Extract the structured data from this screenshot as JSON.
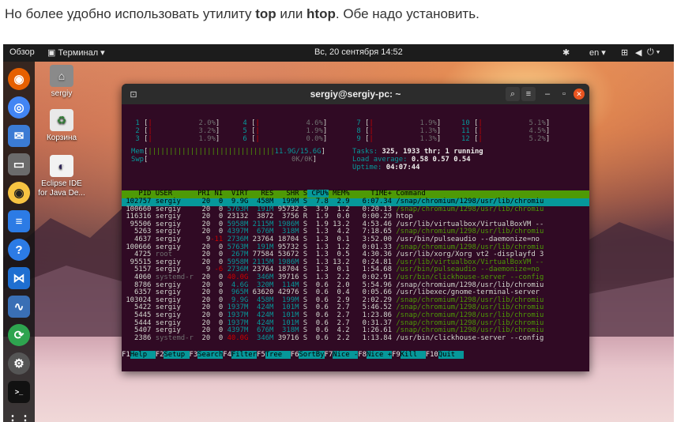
{
  "caption": {
    "before": "Но более удобно использовать утилиту ",
    "bold1": "top",
    "middle": " или ",
    "bold2": "htop",
    "after": ". Обе надо установить."
  },
  "topbar": {
    "activities": "Обзор",
    "app_menu": "Терминал ▾",
    "datetime": "Вс, 20 сентября  14:52",
    "language": "en ▾"
  },
  "desktop_icons": [
    {
      "label": "sergiy"
    },
    {
      "label": "Корзина"
    },
    {
      "label": "Eclipse IDE for Java De..."
    }
  ],
  "terminal": {
    "title": "sergiy@sergiy-pc: ~"
  },
  "htop": {
    "cpus": [
      {
        "id": "1",
        "pct": "2.0%"
      },
      {
        "id": "2",
        "pct": "3.2%"
      },
      {
        "id": "3",
        "pct": "1.9%"
      },
      {
        "id": "4",
        "pct": "4.6%"
      },
      {
        "id": "5",
        "pct": "1.9%"
      },
      {
        "id": "6",
        "pct": "0.0%"
      },
      {
        "id": "7",
        "pct": "1.9%"
      },
      {
        "id": "8",
        "pct": "1.3%"
      },
      {
        "id": "9",
        "pct": "1.3%"
      },
      {
        "id": "10",
        "pct": "5.1%"
      },
      {
        "id": "11",
        "pct": "4.5%"
      },
      {
        "id": "12",
        "pct": "5.2%"
      }
    ],
    "mem_label": "Mem",
    "mem_value": "11.9G/15.6G",
    "swp_label": "Swp",
    "swp_value": "0K/0K",
    "tasks_label": "Tasks: ",
    "tasks_value": "325, 1933 thr; 1 running",
    "load_label": "Load average: ",
    "load_value": "0.58 0.57 0.54",
    "uptime_label": "Uptime: ",
    "uptime_value": "04:07:44",
    "columns": [
      "PID",
      "USER",
      "PRI",
      "NI",
      "VIRT",
      "RES",
      "SHR",
      "S",
      "CPU%",
      "MEM%",
      "TIME+",
      "Command"
    ],
    "processes": [
      [
        "102757",
        "sergiy",
        "20",
        "0",
        "9.9G",
        "458M",
        "199M",
        "S",
        "7.8",
        "2.9",
        "6:07.34",
        "/snap/chromium/1298/usr/lib/chromiu"
      ],
      [
        "100660",
        "sergiy",
        "20",
        "0",
        "5763M",
        "191M",
        "95732",
        "S",
        "3.9",
        "1.2",
        "0:20.13",
        "/snap/chromium/1298/usr/lib/chromiu"
      ],
      [
        "116316",
        "sergiy",
        "20",
        "0",
        "23132",
        "3872",
        "3756",
        "R",
        "1.9",
        "0.0",
        "0:00.29",
        "htop"
      ],
      [
        "95506",
        "sergiy",
        "20",
        "0",
        "5958M",
        "2115M",
        "1986M",
        "S",
        "1.9",
        "13.2",
        "4:53.46",
        "/usr/lib/virtualbox/VirtualBoxVM --"
      ],
      [
        "5263",
        "sergiy",
        "20",
        "0",
        "4397M",
        "676M",
        "318M",
        "S",
        "1.3",
        "4.2",
        "7:18.65",
        "/snap/chromium/1298/usr/lib/chromiu"
      ],
      [
        "4637",
        "sergiy",
        "9",
        "-11",
        "2736M",
        "23764",
        "18704",
        "S",
        "1.3",
        "0.1",
        "3:52.00",
        "/usr/bin/pulseaudio --daemonize=no"
      ],
      [
        "100666",
        "sergiy",
        "20",
        "0",
        "5763M",
        "191M",
        "95732",
        "S",
        "1.3",
        "1.2",
        "0:01.33",
        "/snap/chromium/1298/usr/lib/chromiu"
      ],
      [
        "4725",
        "root",
        "20",
        "0",
        "267M",
        "77584",
        "53672",
        "S",
        "1.3",
        "0.5",
        "4:30.36",
        "/usr/lib/xorg/Xorg vt2 -displayfd 3"
      ],
      [
        "95515",
        "sergiy",
        "20",
        "0",
        "5958M",
        "2115M",
        "1986M",
        "S",
        "1.3",
        "13.2",
        "0:24.81",
        "/usr/lib/virtualbox/VirtualBoxVM --"
      ],
      [
        "5157",
        "sergiy",
        "9",
        "-6",
        "2736M",
        "23764",
        "18704",
        "S",
        "1.3",
        "0.1",
        "1:54.68",
        "/usr/bin/pulseaudio --daemonize=no"
      ],
      [
        "4060",
        "systemd-r",
        "20",
        "0",
        "40.0G",
        "346M",
        "39716",
        "S",
        "1.3",
        "2.2",
        "0:02.91",
        "/usr/bin/clickhouse-server --config"
      ],
      [
        "8786",
        "sergiy",
        "20",
        "0",
        "4.6G",
        "320M",
        "114M",
        "S",
        "0.6",
        "2.0",
        "5:54.96",
        "/snap/chromium/1298/usr/lib/chromiu"
      ],
      [
        "6357",
        "sergiy",
        "20",
        "0",
        "965M",
        "63620",
        "42976",
        "S",
        "0.6",
        "0.4",
        "0:05.66",
        "/usr/libexec/gnome-terminal-server"
      ],
      [
        "103024",
        "sergiy",
        "20",
        "0",
        "9.9G",
        "458M",
        "199M",
        "S",
        "0.6",
        "2.9",
        "2:02.29",
        "/snap/chromium/1298/usr/lib/chromiu"
      ],
      [
        "5422",
        "sergiy",
        "20",
        "0",
        "1937M",
        "424M",
        "101M",
        "S",
        "0.6",
        "2.7",
        "5:46.52",
        "/snap/chromium/1298/usr/lib/chromiu"
      ],
      [
        "5445",
        "sergiy",
        "20",
        "0",
        "1937M",
        "424M",
        "101M",
        "S",
        "0.6",
        "2.7",
        "1:23.86",
        "/snap/chromium/1298/usr/lib/chromiu"
      ],
      [
        "5444",
        "sergiy",
        "20",
        "0",
        "1937M",
        "424M",
        "101M",
        "S",
        "0.6",
        "2.7",
        "0:31.37",
        "/snap/chromium/1298/usr/lib/chromiu"
      ],
      [
        "5407",
        "sergiy",
        "20",
        "0",
        "4397M",
        "676M",
        "318M",
        "S",
        "0.6",
        "4.2",
        "1:26.61",
        "/snap/chromium/1298/usr/lib/chromiu"
      ],
      [
        "2386",
        "systemd-r",
        "20",
        "0",
        "40.0G",
        "346M",
        "39716",
        "S",
        "0.6",
        "2.2",
        "1:13.84",
        "/usr/bin/clickhouse-server --config"
      ]
    ],
    "fkeys": [
      {
        "key": "F1",
        "label": "Help"
      },
      {
        "key": "F2",
        "label": "Setup"
      },
      {
        "key": "F3",
        "label": "Search"
      },
      {
        "key": "F4",
        "label": "Filter"
      },
      {
        "key": "F5",
        "label": "Tree"
      },
      {
        "key": "F6",
        "label": "SortBy"
      },
      {
        "key": "F7",
        "label": "Nice -"
      },
      {
        "key": "F8",
        "label": "Nice +"
      },
      {
        "key": "F9",
        "label": "Kill"
      },
      {
        "key": "F10",
        "label": "Quit"
      }
    ]
  },
  "colors": {
    "terminal_bg": "#300a24",
    "header_green": "#4e9a06",
    "selection_cyan": "#06989a",
    "topbar": "#1c1c1c"
  }
}
